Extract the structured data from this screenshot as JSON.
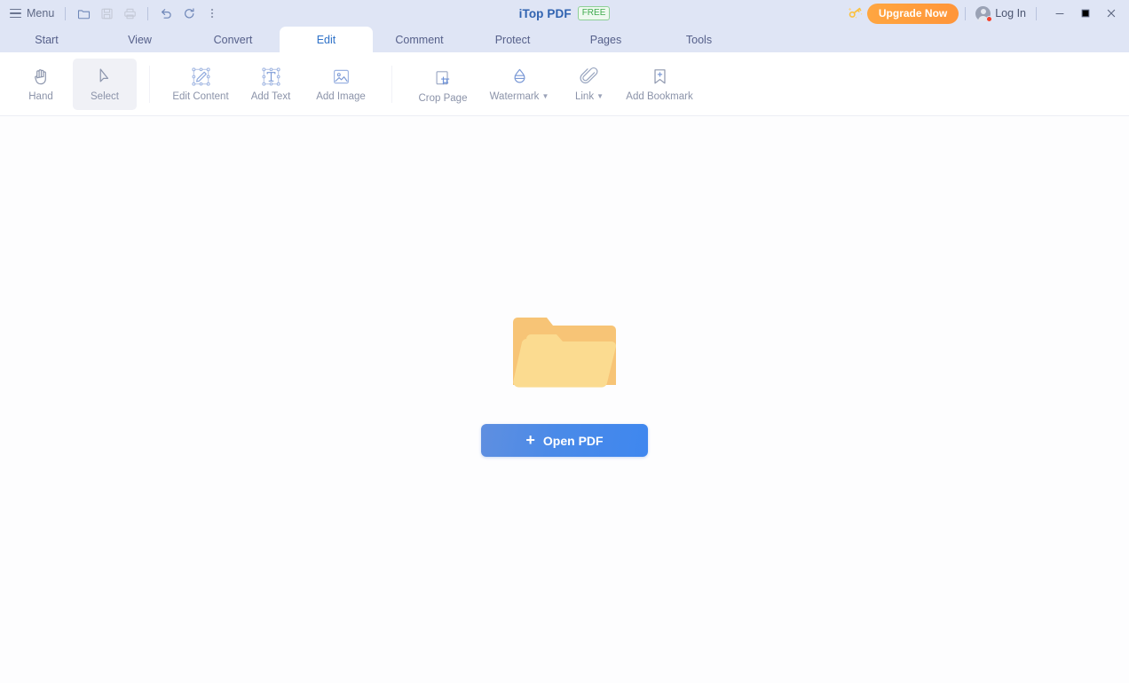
{
  "titlebar": {
    "menu_label": "Menu",
    "menu_icon": "hamburger-icon",
    "quick_actions": [
      {
        "name": "open-file-icon",
        "title": "Open"
      },
      {
        "name": "save-icon",
        "title": "Save"
      },
      {
        "name": "print-icon",
        "title": "Print"
      },
      {
        "name": "undo-icon",
        "title": "Undo"
      },
      {
        "name": "redo-icon",
        "title": "Redo"
      },
      {
        "name": "more-options-icon",
        "title": "More"
      }
    ],
    "app_title": "iTop PDF",
    "license_badge": "FREE",
    "key_icon": "key-icon",
    "upgrade_label": "Upgrade Now",
    "login_label": "Log In",
    "avatar_icon": "user-avatar-icon",
    "notification_dot": true,
    "window_controls": {
      "minimize": "minimize-icon",
      "maximize": "maximize-icon",
      "close": "close-icon"
    }
  },
  "tabs": [
    {
      "label": "Start",
      "active": false
    },
    {
      "label": "View",
      "active": false
    },
    {
      "label": "Convert",
      "active": false
    },
    {
      "label": "Edit",
      "active": true
    },
    {
      "label": "Comment",
      "active": false
    },
    {
      "label": "Protect",
      "active": false
    },
    {
      "label": "Pages",
      "active": false
    },
    {
      "label": "Tools",
      "active": false
    }
  ],
  "ribbon": {
    "groups": [
      {
        "items": [
          {
            "label": "Hand",
            "icon": "hand-icon",
            "selected": false,
            "dropdown": false
          },
          {
            "label": "Select",
            "icon": "cursor-arrow-icon",
            "selected": true,
            "dropdown": false
          }
        ]
      },
      {
        "items": [
          {
            "label": "Edit Content",
            "icon": "edit-content-icon",
            "selected": false,
            "dropdown": false
          },
          {
            "label": "Add Text",
            "icon": "add-text-icon",
            "selected": false,
            "dropdown": false
          },
          {
            "label": "Add Image",
            "icon": "add-image-icon",
            "selected": false,
            "dropdown": false
          }
        ]
      },
      {
        "items": [
          {
            "label": "Crop Page",
            "icon": "crop-page-icon",
            "selected": false,
            "dropdown": false
          },
          {
            "label": "Watermark",
            "icon": "watermark-icon",
            "selected": false,
            "dropdown": true
          },
          {
            "label": "Link",
            "icon": "link-icon",
            "selected": false,
            "dropdown": true
          },
          {
            "label": "Add Bookmark",
            "icon": "add-bookmark-icon",
            "selected": false,
            "dropdown": false
          }
        ]
      }
    ]
  },
  "content": {
    "illustration": "open-folder-illustration",
    "open_button_label": "Open PDF",
    "open_button_plus": "+"
  },
  "colors": {
    "header_bg": "#dfe5f5",
    "accent_blue": "#2f72c8",
    "upgrade_orange": "#ff9c3c",
    "free_green": "#3faa4e",
    "folder_back": "#f9c978",
    "folder_front": "#fbdc93",
    "button_blue": "#4a8ae8",
    "notification_red": "#f5412c"
  }
}
